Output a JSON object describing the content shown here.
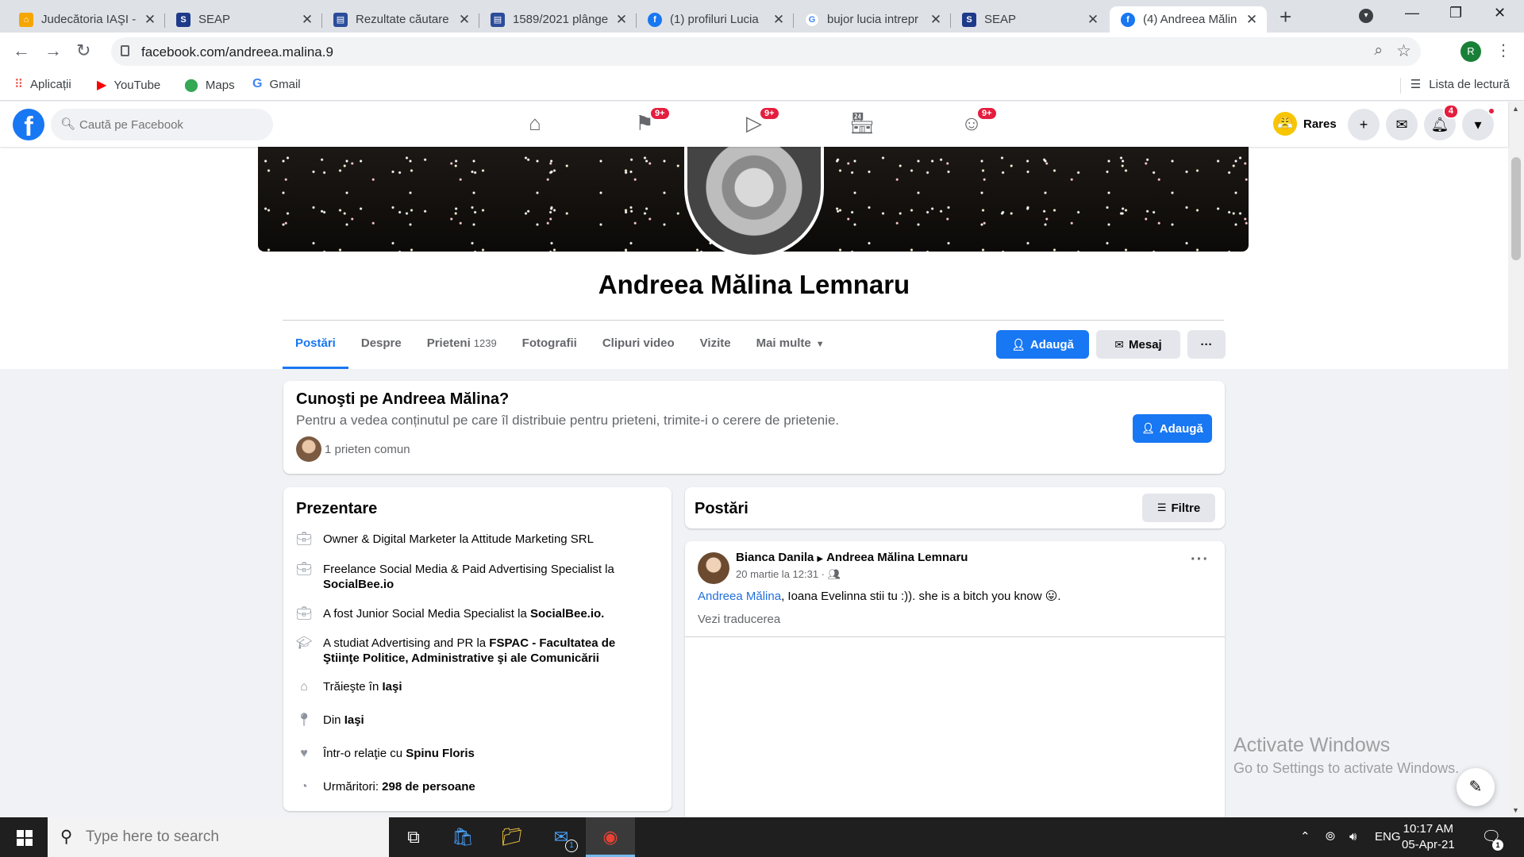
{
  "browser": {
    "tabs": [
      {
        "title": "Judecătoria IAŞI -",
        "icon": "courthouse-icon",
        "color": "#f6a600"
      },
      {
        "title": "SEAP",
        "icon": "seap-icon",
        "color": "#1e3a8a"
      },
      {
        "title": "Rezultate căutare",
        "icon": "document-icon",
        "color": "#2b4c9b"
      },
      {
        "title": "1589/2021 plânge",
        "icon": "document-icon",
        "color": "#2b4c9b"
      },
      {
        "title": "(1) profiluri Lucia",
        "icon": "facebook-icon",
        "color": "#1877f2"
      },
      {
        "title": "bujor lucia intrepr",
        "icon": "google-icon",
        "color": "#4285f4"
      },
      {
        "title": "SEAP",
        "icon": "seap-icon",
        "color": "#1e3a8a"
      },
      {
        "title": "(4) Andreea Mălin",
        "icon": "facebook-icon",
        "color": "#1877f2"
      }
    ],
    "url": "facebook.com/andreea.malina.9",
    "profile_initial": "R",
    "bookmarks": [
      {
        "label": "Aplicații",
        "icon": "apps-grid-icon"
      },
      {
        "label": "YouTube",
        "icon": "youtube-icon"
      },
      {
        "label": "Maps",
        "icon": "maps-pin-icon"
      },
      {
        "label": "Gmail",
        "icon": "gmail-icon"
      }
    ],
    "reading_list": "Lista de lectură"
  },
  "fb": {
    "search_placeholder": "Caută pe Facebook",
    "nav_badges": {
      "pages": "9+",
      "watch": "9+",
      "groups": "9+"
    },
    "user_name": "Rares",
    "notifications_count": "4"
  },
  "profile": {
    "name": "Andreea Mălina Lemnaru",
    "tabs": [
      {
        "label": "Postări"
      },
      {
        "label": "Despre"
      },
      {
        "label": "Prieteni",
        "count": "1239"
      },
      {
        "label": "Fotografii"
      },
      {
        "label": "Clipuri video"
      },
      {
        "label": "Vizite"
      },
      {
        "label": "Mai multe"
      }
    ],
    "add_label": "Adaugă",
    "message_label": "Mesaj",
    "more_label": "···"
  },
  "know": {
    "title": "Cunoşti pe Andreea Mălina?",
    "subtitle": "Pentru a vedea conținutul pe care îl distribuie pentru prieteni, trimite-i o cerere de prietenie.",
    "mutual": "1 prieten comun",
    "add_label": "Adaugă"
  },
  "intro": {
    "title": "Prezentare",
    "items": [
      {
        "icon": "briefcase-icon",
        "prefix": "Owner & Digital Marketer la Attitude Marketing SRL",
        "bold": ""
      },
      {
        "icon": "briefcase-icon",
        "prefix": "Freelance Social Media & Paid Advertising Specialist la ",
        "bold": "SocialBee.io"
      },
      {
        "icon": "briefcase-icon",
        "prefix": "A fost Junior Social Media Specialist la ",
        "bold": "SocialBee.io."
      },
      {
        "icon": "graduation-cap-icon",
        "prefix": "A studiat Advertising and PR la ",
        "bold": "FSPAC - Facultatea de Ştiinţe Politice, Administrative şi ale Comunicării"
      },
      {
        "icon": "home-icon",
        "prefix": "Trăieşte în ",
        "bold": "Iaşi"
      },
      {
        "icon": "location-pin-icon",
        "prefix": "Din ",
        "bold": "Iaşi"
      },
      {
        "icon": "heart-icon",
        "prefix": "Într-o relaţie cu ",
        "bold": "Spinu Floris"
      },
      {
        "icon": "rss-icon",
        "prefix": "Urmăritori: ",
        "bold": "298 de persoane"
      }
    ]
  },
  "posts": {
    "title": "Postări",
    "filter_label": "Filtre",
    "post": {
      "author": "Bianca Danila",
      "target": "Andreea Mălina Lemnaru",
      "meta": "20 martie la 12:31 ·",
      "mention": "Andreea Mălina",
      "text": ", Ioana Evelinna stii tu :)). she is a bitch you know 😛.",
      "translate": "Vezi traducerea"
    }
  },
  "watermark": {
    "line1": "Activate Windows",
    "line2": "Go to Settings to activate Windows."
  },
  "taskbar": {
    "search_placeholder": "Type here to search",
    "mail_badge": "1",
    "lang": "ENG",
    "time": "10:17 AM",
    "date": "05-Apr-21",
    "notif_count": "1"
  }
}
